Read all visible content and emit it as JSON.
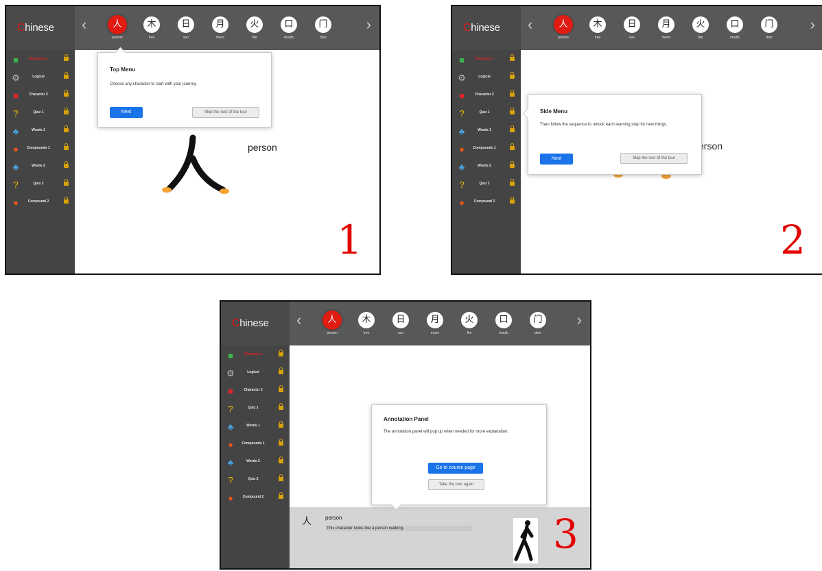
{
  "brand": {
    "first_letter": "C",
    "rest": "hinese"
  },
  "nav": {
    "prev": "‹",
    "next": "›"
  },
  "characters": [
    {
      "glyph": "人",
      "label": "person"
    },
    {
      "glyph": "木",
      "label": "tree"
    },
    {
      "glyph": "日",
      "label": "sun"
    },
    {
      "glyph": "月",
      "label": "moon"
    },
    {
      "glyph": "火",
      "label": "fire"
    },
    {
      "glyph": "口",
      "label": "mouth"
    },
    {
      "glyph": "门",
      "label": "door"
    }
  ],
  "sidebar": [
    {
      "label": "Character 1",
      "icon": "green-cube-icon"
    },
    {
      "label": "Logical",
      "icon": "gear-icon"
    },
    {
      "label": "Character 2",
      "icon": "red-cube-icon"
    },
    {
      "label": "Quiz 1",
      "icon": "question-icon"
    },
    {
      "label": "Words 1",
      "icon": "cubes-icon"
    },
    {
      "label": "Compounds 1",
      "icon": "compound-icon"
    },
    {
      "label": "Words 2",
      "icon": "cubes-icon"
    },
    {
      "label": "Quiz 2",
      "icon": "question-icon"
    },
    {
      "label": "Compound 2",
      "icon": "compound-icon"
    }
  ],
  "panel1": {
    "number": "1",
    "dialog": {
      "title": "Top Menu",
      "body": "Choose any character to start with your journey.",
      "next": "Next",
      "skip": "Skip the rest of the tour"
    },
    "char_glyph": "人",
    "word": "person"
  },
  "panel2": {
    "number": "2",
    "dialog": {
      "title": "Side Menu",
      "body": "Then follow the sequence to unlock each learning step for new things.",
      "next": "Next",
      "skip": "Skip the rest of the tour"
    },
    "word": "erson"
  },
  "panel3": {
    "number": "3",
    "dialog": {
      "title": "Annotation Panel",
      "body": "The annotation panel will pop up when needed for more explanation.",
      "go": "Go to course page",
      "again": "Take the tour again"
    },
    "annotation": {
      "glyph": "人",
      "word": "person",
      "desc": "This character looks like a person walking."
    }
  },
  "colors": {
    "accent_red": "#e01b12",
    "button_blue": "#1a73e8",
    "topbar": "#585858",
    "sidebar": "#444444"
  }
}
